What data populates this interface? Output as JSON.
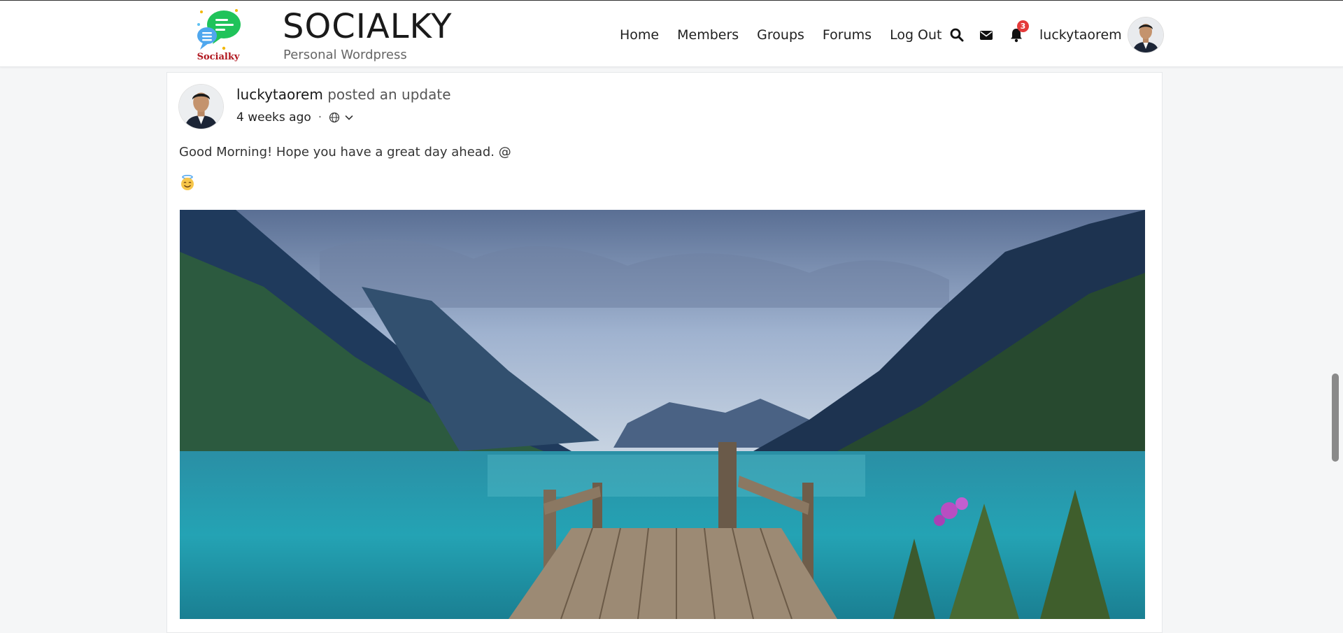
{
  "site": {
    "title": "SOCIALKY",
    "subtitle": "Personal Wordpress",
    "logo_text": "Socialky"
  },
  "nav": {
    "items": [
      {
        "label": "Home"
      },
      {
        "label": "Members"
      },
      {
        "label": "Groups"
      },
      {
        "label": "Forums"
      },
      {
        "label": "Log Out"
      }
    ]
  },
  "header_icons": {
    "search": "search-icon",
    "messages": "envelope-icon",
    "notifications": "bell-icon",
    "notification_count": "3"
  },
  "user": {
    "name": "luckytaorem"
  },
  "post": {
    "author": "luckytaorem",
    "action": "posted an update",
    "time": "4 weeks ago",
    "separator": "·",
    "privacy_icon": "globe-icon",
    "text": "Good Morning! Hope you have a great day ahead. @",
    "emoji": "smiling-face-with-halo"
  },
  "colors": {
    "badge": "#e43a3a",
    "logo_green": "#20c35a",
    "logo_blue": "#4fa7ee",
    "logo_red": "#b0161e"
  }
}
